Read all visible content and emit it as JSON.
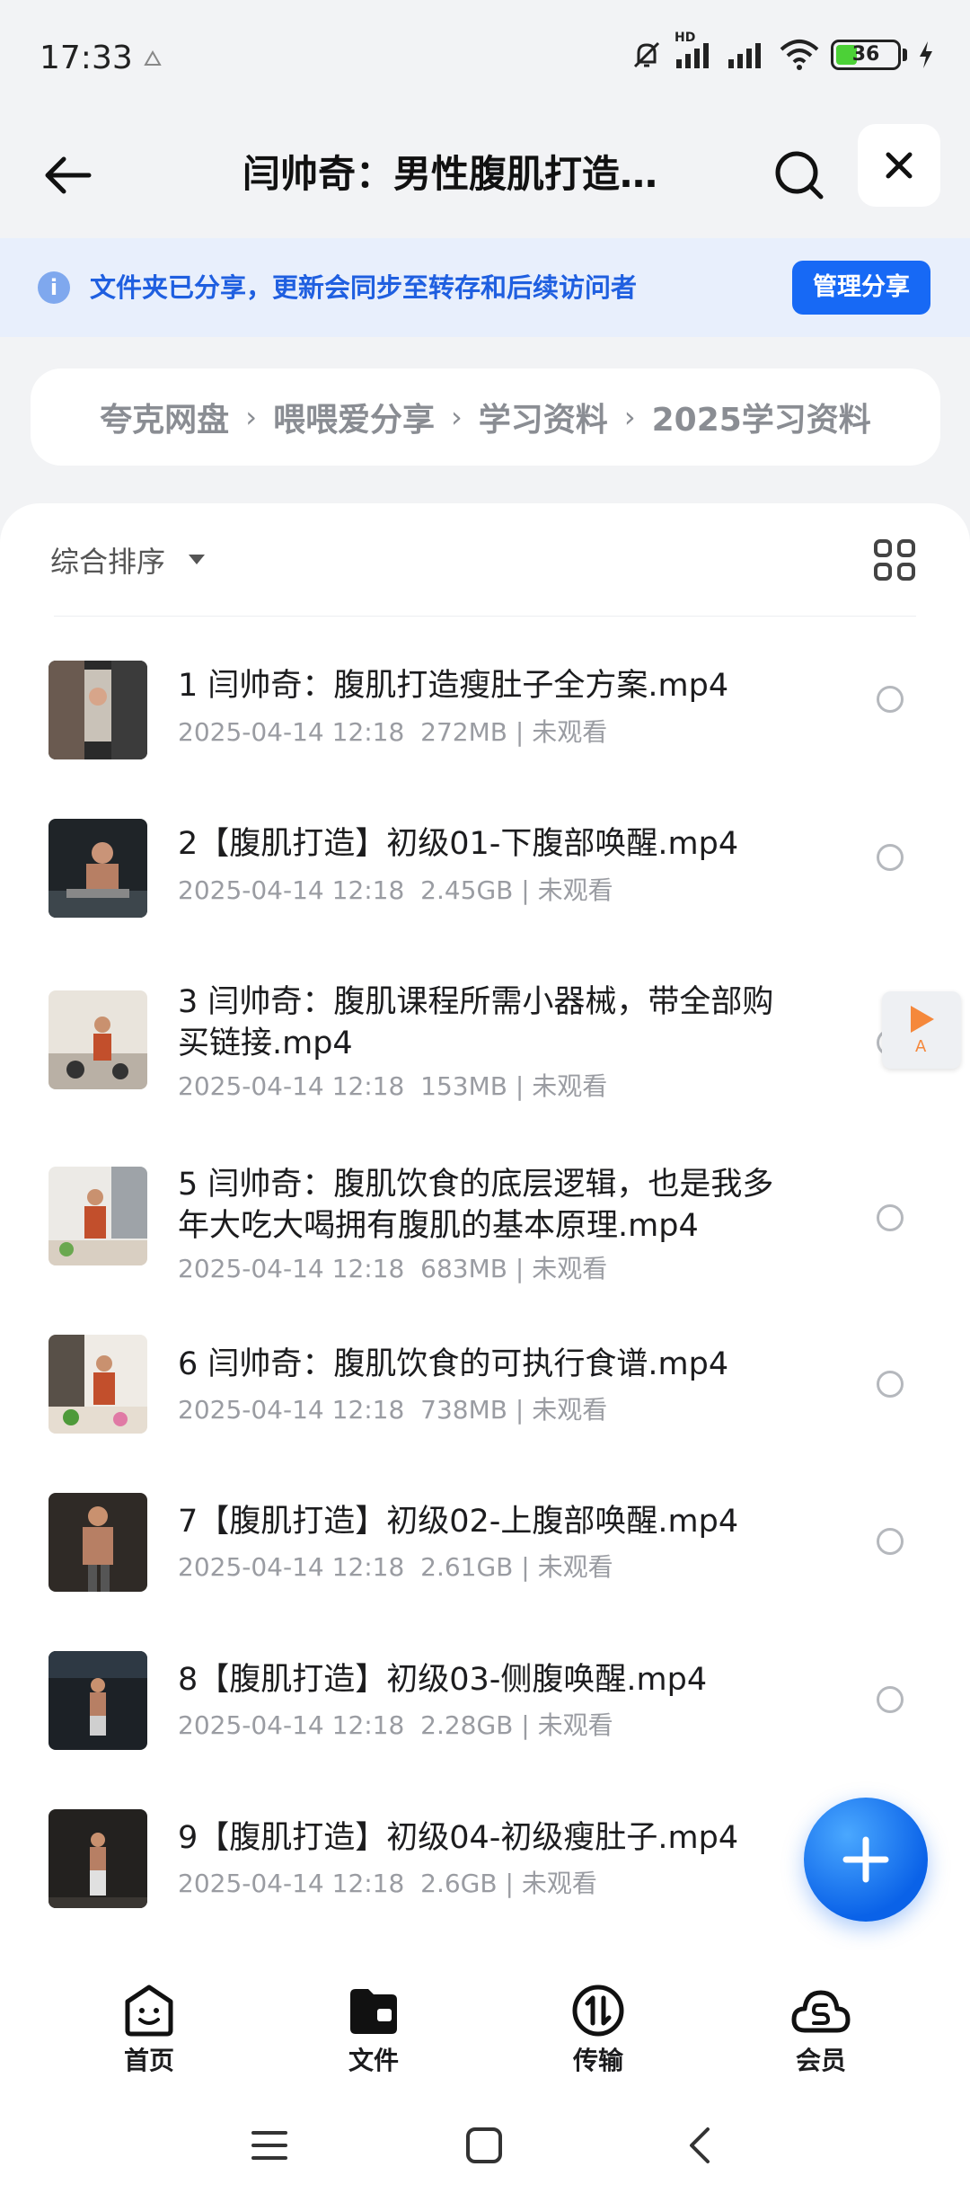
{
  "status_bar": {
    "time": "17:33",
    "network_label": "HD",
    "battery": "36",
    "battery_level": 0.36
  },
  "header": {
    "title": "闫帅奇：男性腹肌打造…"
  },
  "banner": {
    "text": "文件夹已分享，更新会同步至转存和后续访问者",
    "button": "管理分享"
  },
  "breadcrumb": [
    "夸克网盘",
    "喂喂爱分享",
    "学习资料",
    "2025学习资料"
  ],
  "sort": {
    "label": "综合排序"
  },
  "files": [
    {
      "name": "1 闫帅奇：腹肌打造瘦肚子全方案.mp4",
      "date": "2025-04-14 12:18",
      "size": "272MB",
      "status": "未观看",
      "thumb": "gym-montage"
    },
    {
      "name": "2【腹肌打造】初级01-下腹部唤醒.mp4",
      "date": "2025-04-14 12:18",
      "size": "2.45GB",
      "status": "未观看",
      "thumb": "floor-exercise"
    },
    {
      "name": "3 闫帅奇：腹肌课程所需小器械，带全部购买链接.mp4",
      "date": "2025-04-14 12:18",
      "size": "153MB",
      "status": "未观看",
      "thumb": "equipment"
    },
    {
      "name": "5 闫帅奇：腹肌饮食的底层逻辑，也是我多年大吃大喝拥有腹肌的基本原理.mp4",
      "date": "2025-04-14 12:18",
      "size": "683MB",
      "status": "未观看",
      "thumb": "kitchen"
    },
    {
      "name": "6 闫帅奇：腹肌饮食的可执行食谱.mp4",
      "date": "2025-04-14 12:18",
      "size": "738MB",
      "status": "未观看",
      "thumb": "kitchen-food"
    },
    {
      "name": "7【腹肌打造】初级02-上腹部唤醒.mp4",
      "date": "2025-04-14 12:18",
      "size": "2.61GB",
      "status": "未观看",
      "thumb": "abs-closeup"
    },
    {
      "name": "8【腹肌打造】初级03-侧腹唤醒.mp4",
      "date": "2025-04-14 12:18",
      "size": "2.28GB",
      "status": "未观看",
      "thumb": "dark-gym"
    },
    {
      "name": "9【腹肌打造】初级04-初级瘦肚子.mp4",
      "date": "2025-04-14 12:18",
      "size": "2.6GB",
      "status": "未观看",
      "thumb": "dark-gym-standing"
    }
  ],
  "float_tag": {
    "letter": "A"
  },
  "bottom_nav": [
    {
      "label": "首页",
      "icon": "smiley-home-icon"
    },
    {
      "label": "文件",
      "icon": "folder-icon"
    },
    {
      "label": "传输",
      "icon": "transfer-icon"
    },
    {
      "label": "会员",
      "icon": "vip-cloud-icon"
    }
  ],
  "colors": {
    "accent": "#1769f5",
    "banner_bg": "#e8effc",
    "banner_text": "#1f5fe0"
  }
}
